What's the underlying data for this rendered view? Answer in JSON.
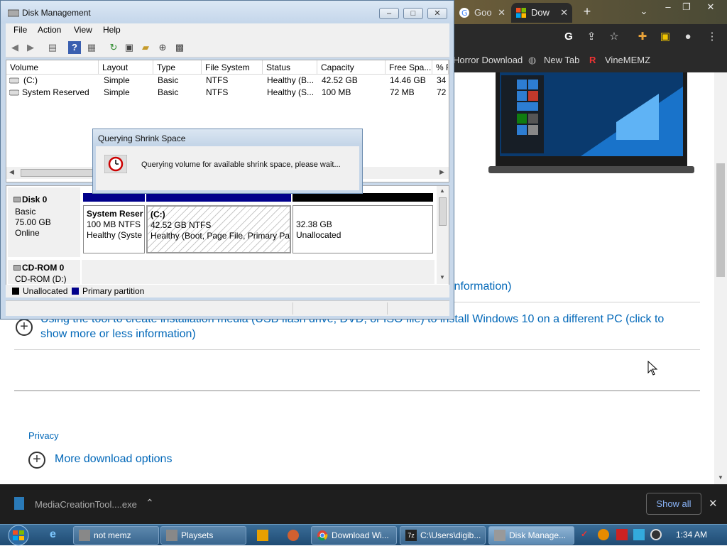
{
  "chrome": {
    "tabs": [
      {
        "label": "Goo"
      },
      {
        "label": "Dow"
      }
    ],
    "bookmarks": [
      {
        "label": "Horror Download"
      },
      {
        "label": "New Tab"
      },
      {
        "label": "VineMEMZ"
      }
    ],
    "page": {
      "partial_link": "information)",
      "media_link": "Using the tool to create installation media (USB flash drive, DVD, or ISO file) to install Windows 10 on a different PC (click to show more or less information)",
      "privacy_label": "Privacy",
      "more_download_label": "More download options"
    },
    "download_bar": {
      "file_name": "MediaCreationTool....exe",
      "show_all_label": "Show all"
    }
  },
  "disk_management": {
    "title": "Disk Management",
    "menu": [
      "File",
      "Action",
      "View",
      "Help"
    ],
    "columns": [
      "Volume",
      "Layout",
      "Type",
      "File System",
      "Status",
      "Capacity",
      "Free Spa...",
      "% F"
    ],
    "volumes": [
      {
        "volume": "(C:)",
        "layout": "Simple",
        "type": "Basic",
        "fs": "NTFS",
        "status": "Healthy (B...",
        "capacity": "42.52 GB",
        "free": "14.46 GB",
        "pct": "34"
      },
      {
        "volume": "System Reserved",
        "layout": "Simple",
        "type": "Basic",
        "fs": "NTFS",
        "status": "Healthy (S...",
        "capacity": "100 MB",
        "free": "72 MB",
        "pct": "72"
      }
    ],
    "disks": [
      {
        "name": "Disk 0",
        "kind": "Basic",
        "size": "75.00 GB",
        "state": "Online",
        "partitions": [
          {
            "name": "System Reser",
            "size": "100 MB NTFS",
            "status": "Healthy (Syste"
          },
          {
            "name": "(C:)",
            "size": "42.52 GB NTFS",
            "status": "Healthy (Boot, Page File, Primary Pa"
          },
          {
            "name": "",
            "size": "32.38 GB",
            "status": "Unallocated"
          }
        ]
      },
      {
        "name": "CD-ROM 0",
        "kind": "CD-ROM (D:)"
      }
    ],
    "legend": [
      "Unallocated",
      "Primary partition"
    ]
  },
  "dialog": {
    "title": "Querying Shrink Space",
    "message": "Querying volume for available shrink space, please wait..."
  },
  "taskbar": {
    "buttons": [
      {
        "label": "not memz"
      },
      {
        "label": "Playsets"
      },
      {
        "label": "Download Wi..."
      },
      {
        "label": "C:\\Users\\digib..."
      },
      {
        "label": "Disk Manage..."
      }
    ],
    "clock": "1:34 AM"
  },
  "colors": {
    "primary_partition": "#00008b",
    "unallocated": "#000000",
    "link": "#0067b8"
  }
}
